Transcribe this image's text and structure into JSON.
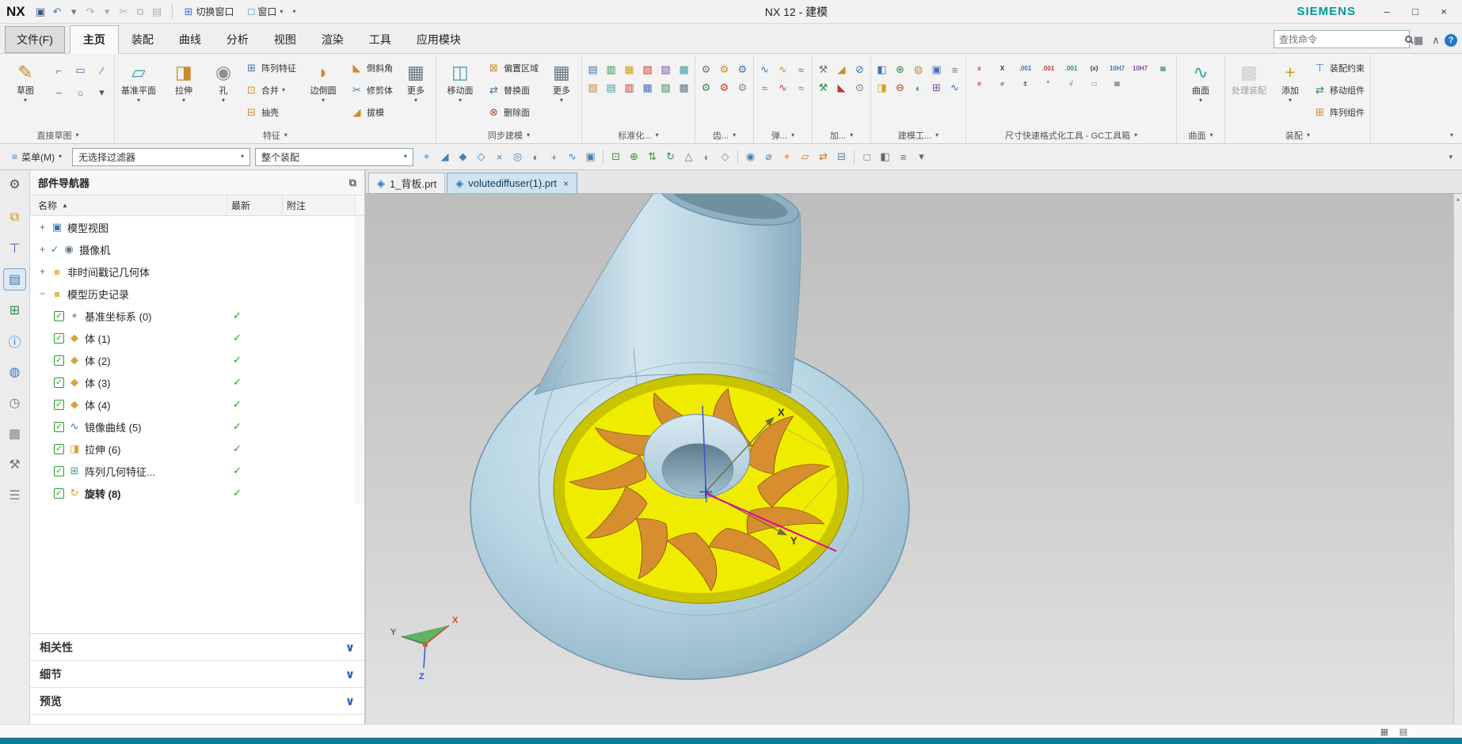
{
  "colors": {
    "teal_bar": "#0f7f93",
    "brand": "#009999",
    "yellow": "#f0ec00",
    "yellow_rim": "#c9c400",
    "body_blue": "#b7d2e0",
    "blade": "#d78e2e",
    "magenta": "#e800a0",
    "active_tab": "#cfe3f0"
  },
  "icons": {
    "caret": {
      "g": "▾",
      "c": "#555"
    },
    "caret_up": {
      "g": "▴",
      "c": "#888"
    },
    "sort": {
      "g": "▲",
      "c": "#444"
    },
    "chevron": {
      "g": "∨",
      "c": "#2b5fb4"
    },
    "checkbox": {
      "g": "✓",
      "c": "#18a018"
    },
    "help": {
      "g": "?",
      "c": "#ffffff"
    },
    "layout": {
      "g": "▦",
      "c": "#556"
    },
    "collapse": {
      "g": "∧",
      "c": "#556"
    },
    "panel_options": {
      "g": "⧉",
      "c": "#667"
    },
    "gear": {
      "g": "⚙",
      "c": "#555"
    },
    "win_min": {
      "g": "–",
      "c": "#333"
    },
    "win_max": {
      "g": "□",
      "c": "#333"
    },
    "win_close": {
      "g": "×",
      "c": "#333"
    },
    "menu_btn": {
      "g": "≡",
      "c": "#3a76c4"
    },
    "switch_window": {
      "g": "⊞",
      "c": "#3a76c4"
    },
    "window": {
      "g": "□",
      "c": "#3a76c4"
    },
    "sketch": {
      "g": "✎",
      "c": "#c28a2e"
    }
  },
  "titlebar": {
    "logo": "NX",
    "title": "NX 12 - 建模",
    "brand": "SIEMENS",
    "switch_window": "切换窗口",
    "window_menu": "窗口",
    "quick_icons": [
      {
        "name": "save-icon",
        "g": "▣",
        "c": "#3a5a8c"
      },
      {
        "name": "undo-icon",
        "g": "↶",
        "c": "#3a76c4"
      },
      {
        "name": "undo-caret-icon",
        "g": "▾",
        "c": "#777"
      },
      {
        "name": "redo-icon",
        "g": "↷",
        "c": "#a8b0ba"
      },
      {
        "name": "redo-caret-icon",
        "g": "▾",
        "c": "#a8b0ba"
      },
      {
        "name": "cut-icon",
        "g": "✂",
        "c": "#a8b0ba"
      },
      {
        "name": "copy-icon",
        "g": "⧉",
        "c": "#a8b0ba"
      },
      {
        "name": "paste-icon",
        "g": "▤",
        "c": "#a8b0ba"
      }
    ]
  },
  "menu_tabs": [
    "文件(F)",
    "主页",
    "装配",
    "曲线",
    "分析",
    "视图",
    "渲染",
    "工具",
    "应用模块"
  ],
  "search": {
    "placeholder": "查找命令"
  },
  "ribbon": {
    "sketch": {
      "label": "直接草图",
      "big": "草图",
      "minis": [
        {
          "name": "profile-icon",
          "g": "⌐",
          "c": "#3f76b0"
        },
        {
          "name": "rectangle-icon",
          "g": "▭",
          "c": "#3f76b0"
        },
        {
          "name": "line-icon",
          "g": "∕",
          "c": "#3f76b0"
        },
        {
          "name": "arc-icon",
          "g": "⌣",
          "c": "#3f76b0"
        },
        {
          "name": "circle-icon",
          "g": "○",
          "c": "#3f76b0"
        },
        {
          "name": "sketch-more-icon",
          "g": "▾",
          "c": "#555"
        }
      ]
    },
    "feature": {
      "label": "特征",
      "bigs": [
        {
          "label": "基准平面",
          "ic": {
            "g": "▱",
            "c": "#3f9ea8"
          }
        },
        {
          "label": "拉伸",
          "ic": {
            "g": "◨",
            "c": "#cc8a2e"
          }
        },
        {
          "label": "孔",
          "ic": {
            "g": "◉",
            "c": "#8a8f98"
          }
        }
      ],
      "col1": [
        {
          "label": "阵列特征",
          "ic": {
            "g": "⊞",
            "c": "#3f76b0"
          }
        },
        {
          "label": "合并",
          "ic": {
            "g": "⊡",
            "c": "#cc8a2e"
          }
        },
        {
          "label": "抽壳",
          "ic": {
            "g": "⊟",
            "c": "#cc8a2e"
          }
        }
      ],
      "big_blend": {
        "label": "边倒圆",
        "ic": {
          "g": "◗",
          "c": "#cc8a2e"
        }
      },
      "col2": [
        {
          "label": "倒斜角",
          "ic": {
            "g": "◣",
            "c": "#cc8a2e"
          }
        },
        {
          "label": "修剪体",
          "ic": {
            "g": "✂",
            "c": "#3f76b0"
          }
        },
        {
          "label": "拔模",
          "ic": {
            "g": "◢",
            "c": "#cc8a2e"
          }
        }
      ],
      "big_more": {
        "label": "更多",
        "ic": {
          "g": "▦",
          "c": "#667788"
        }
      }
    },
    "sync": {
      "label": "同步建模",
      "big": {
        "label": "移动面",
        "ic": {
          "g": "◫",
          "c": "#3f9ea8"
        }
      },
      "col": [
        {
          "label": "偏置区域",
          "ic": {
            "g": "⊠",
            "c": "#cc8a2e"
          }
        },
        {
          "label": "替换面",
          "ic": {
            "g": "⇄",
            "c": "#3f76b0"
          }
        },
        {
          "label": "删除面",
          "ic": {
            "g": "⊗",
            "c": "#c0392b"
          }
        }
      ],
      "more": {
        "label": "更多",
        "ic": {
          "g": "▦",
          "c": "#667788"
        }
      }
    },
    "std": {
      "label": "标准化...",
      "rows": [
        [
          {
            "name": "std-tool-ic Mountainon",
            "g": "▤",
            "c": "#3f76b0"
          },
          {
            "name": "std-tool-icon",
            "g": "▥",
            "c": "#2e8f4e"
          },
          {
            "name": "std-tool-icon",
            "g": "▦",
            "c": "#d4a017"
          },
          {
            "name": "std-tool-icon",
            "g": "▧",
            "c": "#c0392b"
          },
          {
            "name": "std-tool-icon",
            "g": "▨",
            "c": "#7a4fa0"
          },
          {
            "name": "std-tool-icon",
            "g": "▩",
            "c": "#3f9ea8"
          }
        ],
        [
          {
            "name": "std-tool-icon",
            "g": "▨",
            "c": "#cc8a2e"
          },
          {
            "name": "std-tool-icon",
            "g": "▤",
            "c": "#3f9ea8"
          },
          {
            "name": "std-tool-icon",
            "g": "▥",
            "c": "#c0392b"
          },
          {
            "name": "std-tool-icon",
            "g": "▦",
            "c": "#3f76b0"
          },
          {
            "name": "std-tool-icon",
            "g": "▧",
            "c": "#2e8f4e"
          },
          {
            "name": "std-tool-icon",
            "g": "▩",
            "c": "#667788"
          }
        ]
      ]
    },
    "gear": {
      "label": "齿...",
      "rows": [
        [
          {
            "name": "gear-tool-icon",
            "g": "⚙",
            "c": "#667788"
          },
          {
            "name": "gear-tool-icon",
            "g": "⚙",
            "c": "#cc8a2e"
          },
          {
            "name": "gear-tool-icon",
            "g": "⚙",
            "c": "#3f76b0"
          }
        ],
        [
          {
            "name": "gear-tool-icon",
            "g": "⚙",
            "c": "#2e8f4e"
          },
          {
            "name": "gear-tool-icon",
            "g": "⚙",
            "c": "#c0392b"
          },
          {
            "name": "gear-tool-icon",
            "g": "⚙",
            "c": "#888888"
          }
        ]
      ]
    },
    "spring": {
      "label": "弹...",
      "rows": [
        [
          {
            "name": "spring-tool-icon",
            "g": "∿",
            "c": "#3f76b0"
          },
          {
            "name": "spring-tool-icon",
            "g": "∿",
            "c": "#cc8a2e"
          },
          {
            "name": "spring-tool-icon",
            "g": "≈",
            "c": "#2e8f4e"
          }
        ],
        [
          {
            "name": "spring-tool-icon",
            "g": "≈",
            "c": "#667788"
          },
          {
            "name": "spring-tool-icon",
            "g": "∿",
            "c": "#c0392b"
          },
          {
            "name": "spring-tool-icon",
            "g": "≈",
            "c": "#3f9ea8"
          }
        ]
      ]
    },
    "machining": {
      "label": "加...",
      "rows": [
        [
          {
            "name": "machining-tool-icon",
            "g": "⚒",
            "c": "#667788"
          },
          {
            "name": "machining-tool-icon",
            "g": "◢",
            "c": "#cc8a2e"
          },
          {
            "name": "machining-tool-icon",
            "g": "⊘",
            "c": "#3f76b0"
          }
        ],
        [
          {
            "name": "machining-tool-icon",
            "g": "⚒",
            "c": "#2e8f4e"
          },
          {
            "name": "machining-tool-icon",
            "g": "◣",
            "c": "#c0392b"
          },
          {
            "name": "machining-tool-icon",
            "g": "⊙",
            "c": "#667788"
          }
        ]
      ]
    },
    "modeling": {
      "label": "建模工...",
      "rows": [
        [
          {
            "name": "modeling-tool-icon",
            "g": "◧",
            "c": "#3f76b0"
          },
          {
            "name": "modeling-tool-icon",
            "g": "⊕",
            "c": "#2e8f4e"
          },
          {
            "name": "modeling-tool-icon",
            "g": "◍",
            "c": "#cc8a2e"
          },
          {
            "name": "modeling-tool-icon",
            "g": "▣",
            "c": "#3f76b0"
          },
          {
            "name": "modeling-tool-icon",
            "g": "≡",
            "c": "#667788"
          }
        ],
        [
          {
            "name": "modeling-tool-icon",
            "g": "◨",
            "c": "#d4a017"
          },
          {
            "name": "modeling-tool-icon",
            "g": "⊖",
            "c": "#c0392b"
          },
          {
            "name": "modeling-tool-icon",
            "g": "◐",
            "c": "#3f9ea8"
          },
          {
            "name": "modeling-tool-icon",
            "g": "⊞",
            "c": "#7a4fa0"
          },
          {
            "name": "modeling-tool-icon",
            "g": "∿",
            "c": "#3f76b0"
          }
        ]
      ]
    },
    "gc": {
      "label": "尺寸快速格式化工具 - GC工具箱",
      "rows": [
        [
          {
            "name": "dim-format-icon",
            "g": "x",
            "c": "#c0392b"
          },
          {
            "name": "dim-format-icon",
            "g": "X",
            "c": "#333333"
          },
          {
            "name": "dim-format-icon",
            "g": ".001",
            "c": "#3f76b0"
          },
          {
            "name": "dim-format-icon",
            "g": ".001",
            "c": "#c0392b"
          },
          {
            "name": "dim-format-icon",
            "g": ".001",
            "c": "#2e8f4e"
          },
          {
            "name": "dim-format-icon",
            "g": "(x)",
            "c": "#333333"
          },
          {
            "name": "dim-format-icon",
            "g": "10H7",
            "c": "#3f76b0"
          },
          {
            "name": "dim-format-icon",
            "g": "10H7",
            "c": "#7a4fa0"
          },
          {
            "name": "dim-format-icon",
            "g": "▦",
            "c": "#2e8f4e"
          }
        ],
        [
          {
            "name": "dim-format-icon",
            "g": "⌀",
            "c": "#c0392b"
          },
          {
            "name": "dim-format-icon",
            "g": "⌀",
            "c": "#3f76b0"
          },
          {
            "name": "dim-format-icon",
            "g": "±",
            "c": "#333333"
          },
          {
            "name": "dim-format-icon",
            "g": "°",
            "c": "#333333"
          },
          {
            "name": "dim-format-icon",
            "g": "√",
            "c": "#2e8f4e"
          },
          {
            "name": "dim-format-icon",
            "g": "▭",
            "c": "#3f9ea8"
          },
          {
            "name": "dim-format-icon",
            "g": "▦",
            "c": "#667788"
          }
        ]
      ]
    },
    "surface": {
      "label": "曲面",
      "big": {
        "label": "曲面",
        "ic": {
          "g": "∿",
          "c": "#3f9ea8"
        }
      }
    },
    "assembly": {
      "label": "装配",
      "process": {
        "label": "处理装配",
        "ic": {
          "g": "▩",
          "c": "#99a0a8"
        }
      },
      "add": {
        "label": "添加",
        "ic": {
          "g": "+",
          "c": "#d4a017"
        }
      },
      "col": [
        {
          "label": "装配约束",
          "ic": {
            "g": "⊤",
            "c": "#3f76b0"
          }
        },
        {
          "label": "移动组件",
          "ic": {
            "g": "⇄",
            "c": "#2e8f4e"
          }
        },
        {
          "label": "阵列组件",
          "ic": {
            "g": "⊞",
            "c": "#cc8a2e"
          }
        }
      ]
    }
  },
  "selection_bar": {
    "menu_label": "菜单(M)",
    "filter_value": "无选择过滤器",
    "scope_value": "整个装配",
    "icons": [
      {
        "name": "snap-point-toggle-icon",
        "g": "⌖",
        "c": "#4a7fae"
      },
      {
        "name": "snap-endpoint-icon",
        "g": "◢",
        "c": "#4a7fae"
      },
      {
        "name": "snap-midpoint-icon",
        "g": "◆",
        "c": "#4a7fae"
      },
      {
        "name": "snap-control-point-icon",
        "g": "◇",
        "c": "#4a7fae"
      },
      {
        "name": "snap-intersection-icon",
        "g": "×",
        "c": "#4a7fae"
      },
      {
        "name": "snap-arc-center-icon",
        "g": "◎",
        "c": "#4a7fae"
      },
      {
        "name": "snap-quadrant-icon",
        "g": "◐",
        "c": "#4a7fae"
      },
      {
        "name": "snap-existing-point-icon",
        "g": "+",
        "c": "#4a7fae"
      },
      {
        "name": "snap-point-on-curve-icon",
        "g": "∿",
        "c": "#4a7fae"
      },
      {
        "name": "snap-point-on-face-icon",
        "g": "▣",
        "c": "#4a7fae"
      },
      {
        "sep": true
      },
      {
        "name": "fit-view-icon",
        "g": "⊡",
        "c": "#3f8f3f"
      },
      {
        "name": "zoom-icon",
        "g": "⊕",
        "c": "#3f8f3f"
      },
      {
        "name": "pan-icon",
        "g": "⇅",
        "c": "#3f8f3f"
      },
      {
        "name": "rotate-view-icon",
        "g": "↻",
        "c": "#3f8f3f"
      },
      {
        "name": "perspective-icon",
        "g": "△",
        "c": "#3f8f3f"
      },
      {
        "name": "shaded-view-icon",
        "g": "◐",
        "c": "#888888"
      },
      {
        "name": "wireframe-view-icon",
        "g": "◇",
        "c": "#888888"
      },
      {
        "sep": true
      },
      {
        "name": "show-hide-icon",
        "g": "◉",
        "c": "#4a7fae"
      },
      {
        "name": "measure-icon",
        "g": "⌀",
        "c": "#4a7fae"
      },
      {
        "name": "wcs-icon",
        "g": "⌖",
        "c": "#cc7a22"
      },
      {
        "name": "datum-display-icon",
        "g": "▱",
        "c": "#cc7a22"
      },
      {
        "name": "move-object-icon",
        "g": "⇄",
        "c": "#cc7a22"
      },
      {
        "name": "edit-section-icon",
        "g": "⊟",
        "c": "#4a7fae"
      },
      {
        "sep": true
      },
      {
        "name": "window-display-icon",
        "g": "□",
        "c": "#666666"
      },
      {
        "name": "object-display-icon",
        "g": "◧",
        "c": "#666666"
      },
      {
        "name": "layer-settings-icon",
        "g": "≡",
        "c": "#666666"
      },
      {
        "name": "view-menu-icon",
        "g": "▾",
        "c": "#666666"
      }
    ]
  },
  "leftbar": {
    "icons": [
      {
        "name": "assembly-navigator-icon",
        "g": "⧉",
        "c": "#cc8a2e"
      },
      {
        "name": "constraint-navigator-icon",
        "g": "⊤",
        "c": "#7a4fa0"
      },
      {
        "name": "part-navigator-icon",
        "g": "▤",
        "c": "#3f76b0",
        "active": true
      },
      {
        "name": "reuse-library-icon",
        "g": "⊞",
        "c": "#2e8f4e"
      },
      {
        "name": "hd3d-tool-icon",
        "g": "ⓘ",
        "c": "#2277cc"
      },
      {
        "name": "web-browser-icon",
        "g": "◍",
        "c": "#3a76c4"
      },
      {
        "name": "history-icon",
        "g": "◷",
        "c": "#667788"
      },
      {
        "name": "process-studio-icon",
        "g": "▩",
        "c": "#888888"
      },
      {
        "name": "manufacturing-wizard-icon",
        "g": "⚒",
        "c": "#667788"
      },
      {
        "name": "roles-icon",
        "g": "☰",
        "c": "#888888"
      }
    ]
  },
  "navigator": {
    "title": "部件导航器",
    "columns": {
      "name": "名称",
      "latest": "最新",
      "note": "附注"
    },
    "tree": [
      {
        "expand": "+",
        "label": "模型视图",
        "ic": {
          "g": "▣",
          "c": "#3f76b0"
        }
      },
      {
        "expand": "+",
        "pre": "✓",
        "label": "摄像机",
        "ic": {
          "g": "◉",
          "c": "#667788"
        }
      },
      {
        "expand": "+",
        "label": "非时间戳记几何体",
        "ic": {
          "g": "■",
          "c": "#e8bb55"
        }
      },
      {
        "expand": "−",
        "label": "模型历史记录",
        "ic": {
          "g": "■",
          "c": "#e8bb55"
        }
      }
    ],
    "features": [
      {
        "label": "基准坐标系 (0)",
        "latest": "✓",
        "ic": {
          "g": "⌖",
          "c": "#3f76b0"
        }
      },
      {
        "label": "体 (1)",
        "latest": "✓",
        "ic": {
          "g": "◆",
          "c": "#d9a13c"
        }
      },
      {
        "label": "体 (2)",
        "latest": "✓",
        "ic": {
          "g": "◆",
          "c": "#d9a13c"
        }
      },
      {
        "label": "体 (3)",
        "latest": "✓",
        "ic": {
          "g": "◆",
          "c": "#d9a13c"
        }
      },
      {
        "label": "体 (4)",
        "latest": "✓",
        "ic": {
          "g": "◆",
          "c": "#d9a13c"
        }
      },
      {
        "label": "镜像曲线 (5)",
        "latest": "✓",
        "ic": {
          "g": "∿",
          "c": "#3f76b0"
        }
      },
      {
        "label": "拉伸 (6)",
        "latest": "✓",
        "ic": {
          "g": "◨",
          "c": "#d9a13c"
        }
      },
      {
        "label": "阵列几何特征...",
        "latest": "✓",
        "ic": {
          "g": "⊞",
          "c": "#3f9ea8"
        }
      },
      {
        "label": "旋转 (8)",
        "latest": "✓",
        "ic": {
          "g": "↻",
          "c": "#d9a13c"
        },
        "bold": true
      }
    ],
    "sections": [
      "相关性",
      "细节",
      "预览"
    ]
  },
  "viewport": {
    "tabs": [
      {
        "label": "1_背板.prt",
        "ic": {
          "g": "◈",
          "c": "#2277cc"
        }
      },
      {
        "label": "volutediffuser(1).prt",
        "ic": {
          "g": "◈",
          "c": "#2277cc"
        },
        "close": "×",
        "active": true
      }
    ],
    "axes": {
      "x": "X",
      "y": "Y"
    },
    "triad": {
      "x": "X",
      "y": "Y",
      "z": "Z"
    }
  },
  "status": {
    "icons": [
      {
        "name": "grid-display-icon",
        "g": "▦",
        "c": "#666677"
      },
      {
        "name": "clipboard-icon",
        "g": "▤",
        "c": "#666677"
      }
    ]
  }
}
